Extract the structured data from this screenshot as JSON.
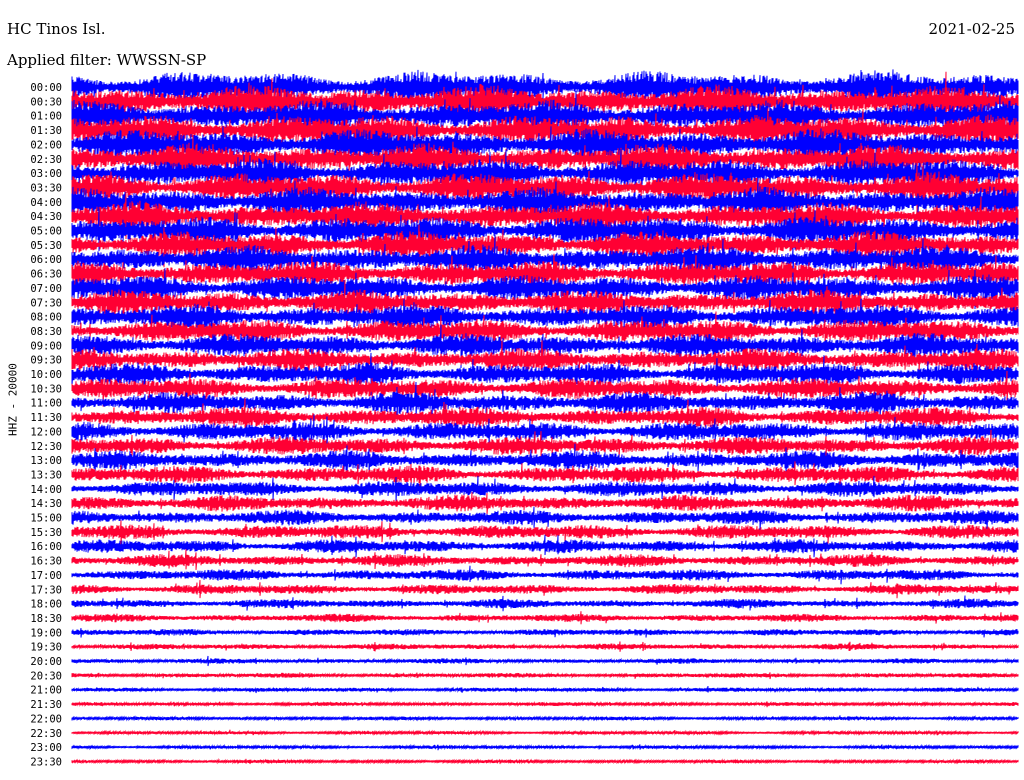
{
  "header": {
    "station": "HC Tinos Isl.",
    "filter": "Applied filter: WWSSN-SP",
    "date": "2021-02-25"
  },
  "colors": {
    "trace_a": "#0000ff",
    "trace_b": "#ff0033",
    "background": "#ffffff",
    "text": "#000000"
  },
  "chart_data": {
    "type": "line",
    "title": "HC Tinos Isl.",
    "subtitle": "Applied filter: WWSSN-SP",
    "ylabel": "HHZ - 20000",
    "xlabel": "",
    "grid": false,
    "legend": "none",
    "line_times": [
      "00:00",
      "00:30",
      "01:00",
      "01:30",
      "02:00",
      "02:30",
      "03:00",
      "03:30",
      "04:00",
      "04:30",
      "05:00",
      "05:30",
      "06:00",
      "06:30",
      "07:00",
      "07:30",
      "08:00",
      "08:30",
      "09:00",
      "09:30",
      "10:00",
      "10:30",
      "11:00",
      "11:30",
      "12:00",
      "12:30",
      "13:00",
      "13:30",
      "14:00",
      "14:30",
      "15:00",
      "15:30",
      "16:00",
      "16:30",
      "17:00",
      "17:30",
      "18:00",
      "18:30",
      "19:00",
      "19:30",
      "20:00",
      "20:30",
      "21:00",
      "21:30",
      "22:00",
      "22:30",
      "23:00",
      "23:30"
    ],
    "line_colors": [
      "#0000ff",
      "#ff0033"
    ],
    "relative_amplitude": [
      2.6,
      2.6,
      2.5,
      2.5,
      2.5,
      2.4,
      2.4,
      2.4,
      2.3,
      2.3,
      2.3,
      2.2,
      2.2,
      2.1,
      2.1,
      2.0,
      2.0,
      1.9,
      1.9,
      1.8,
      1.8,
      1.7,
      1.7,
      1.6,
      1.6,
      1.5,
      1.5,
      1.4,
      1.3,
      1.3,
      1.2,
      1.2,
      1.1,
      1.0,
      0.95,
      0.85,
      0.75,
      0.65,
      0.55,
      0.48,
      0.42,
      0.38,
      0.34,
      0.3,
      0.28,
      0.26,
      0.26,
      0.26
    ]
  }
}
